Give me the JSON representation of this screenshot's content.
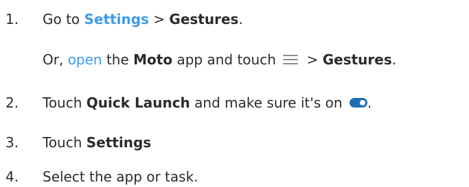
{
  "steps": [
    {
      "number": "1.",
      "lead": "Go to ",
      "settings_link": "Settings",
      "sep": " > ",
      "gestures": "Gestures",
      "end": ".",
      "sub": {
        "prefix": "Or, ",
        "open_link": "open",
        "middle1": " the ",
        "moto": "Moto",
        "middle2": " app and touch ",
        "menu_icon": "menu-icon",
        "sep": " > ",
        "gestures": "Gestures",
        "end": "."
      }
    },
    {
      "number": "2.",
      "lead": "Touch ",
      "quick_launch": "Quick Launch",
      "middle": " and make sure it's on ",
      "toggle_icon": "toggle-on-icon",
      "end": "."
    },
    {
      "number": "3.",
      "lead": "Touch ",
      "settings": "Settings"
    },
    {
      "number": "4.",
      "text": "Select the app or task."
    }
  ],
  "colors": {
    "text": "#2b2b2b",
    "link": "#3d9be9",
    "toggle": "#1f6fb8",
    "icon": "#8a8a8a"
  }
}
